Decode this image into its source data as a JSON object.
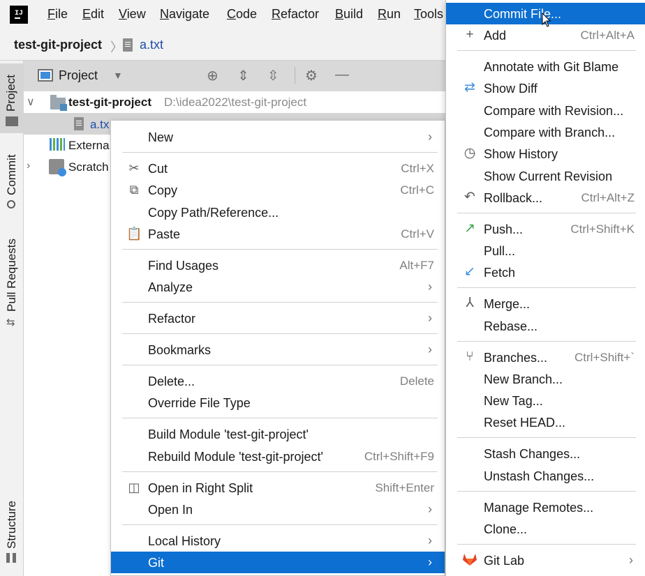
{
  "menubar": {
    "items": [
      {
        "key": "F",
        "rest": "ile"
      },
      {
        "key": "E",
        "rest": "dit"
      },
      {
        "key": "V",
        "rest": "iew"
      },
      {
        "key": "N",
        "rest": "avigate"
      },
      {
        "key": "C",
        "rest": "ode"
      },
      {
        "key": "R",
        "rest": "efactor"
      },
      {
        "key": "B",
        "rest": "uild"
      },
      {
        "key": "R",
        "rest": "un"
      },
      {
        "key": "T",
        "rest": "ools"
      }
    ]
  },
  "breadcrumb": {
    "project": "test-git-project",
    "file": "a.txt"
  },
  "left_strip": {
    "project": "Project",
    "commit": "Commit",
    "pull_requests": "Pull Requests",
    "structure": "Structure"
  },
  "project_panel": {
    "title": "Project",
    "root_name": "test-git-project",
    "root_path": "D:\\idea2022\\test-git-project",
    "file_item": "a.tx",
    "external": "Externa",
    "scratch": "Scratch"
  },
  "context_menu": {
    "items": [
      {
        "label": "New",
        "submenu": true
      },
      {
        "label": "Cut",
        "shortcut": "Ctrl+X",
        "icon": "scissors-icon"
      },
      {
        "label": "Copy",
        "shortcut": "Ctrl+C",
        "icon": "copy-icon"
      },
      {
        "label": "Copy Path/Reference..."
      },
      {
        "label": "Paste",
        "shortcut": "Ctrl+V",
        "icon": "paste-icon"
      },
      {
        "label": "Find Usages",
        "shortcut": "Alt+F7"
      },
      {
        "label": "Analyze",
        "submenu": true
      },
      {
        "label": "Refactor",
        "submenu": true
      },
      {
        "label": "Bookmarks",
        "submenu": true
      },
      {
        "label": "Delete...",
        "shortcut": "Delete"
      },
      {
        "label": "Override File Type"
      },
      {
        "label": "Build Module 'test-git-project'"
      },
      {
        "label": "Rebuild Module 'test-git-project'",
        "shortcut": "Ctrl+Shift+F9"
      },
      {
        "label": "Open in Right Split",
        "shortcut": "Shift+Enter",
        "icon": "split-icon"
      },
      {
        "label": "Open In",
        "submenu": true
      },
      {
        "label": "Local History",
        "submenu": true
      },
      {
        "label": "Git",
        "submenu": true,
        "highlighted": true
      }
    ]
  },
  "git_submenu": {
    "items": [
      {
        "label": "Commit File...",
        "highlighted": true
      },
      {
        "label": "Add",
        "shortcut": "Ctrl+Alt+A",
        "icon": "plus-icon"
      },
      {
        "label": "Annotate with Git Blame"
      },
      {
        "label": "Show Diff",
        "icon": "diff-icon"
      },
      {
        "label": "Compare with Revision..."
      },
      {
        "label": "Compare with Branch..."
      },
      {
        "label": "Show History",
        "icon": "clock-icon"
      },
      {
        "label": "Show Current Revision"
      },
      {
        "label": "Rollback...",
        "shortcut": "Ctrl+Alt+Z",
        "icon": "undo-icon"
      },
      {
        "label": "Push...",
        "shortcut": "Ctrl+Shift+K",
        "icon": "push-arrow-icon"
      },
      {
        "label": "Pull..."
      },
      {
        "label": "Fetch",
        "icon": "fetch-icon"
      },
      {
        "label": "Merge...",
        "icon": "merge-icon"
      },
      {
        "label": "Rebase..."
      },
      {
        "label": "Branches...",
        "shortcut": "Ctrl+Shift+`",
        "icon": "branch-icon"
      },
      {
        "label": "New Branch..."
      },
      {
        "label": "New Tag..."
      },
      {
        "label": "Reset HEAD..."
      },
      {
        "label": "Stash Changes..."
      },
      {
        "label": "Unstash Changes..."
      },
      {
        "label": "Manage Remotes..."
      },
      {
        "label": "Clone..."
      },
      {
        "label": "Git Lab",
        "submenu": true,
        "icon": "gitlab-icon"
      }
    ]
  },
  "colors": {
    "highlight": "#0d6fd1",
    "push_green": "#3fa34d",
    "fetch_blue": "#3e8ddd",
    "gitlab_orange": "#e2432a"
  }
}
